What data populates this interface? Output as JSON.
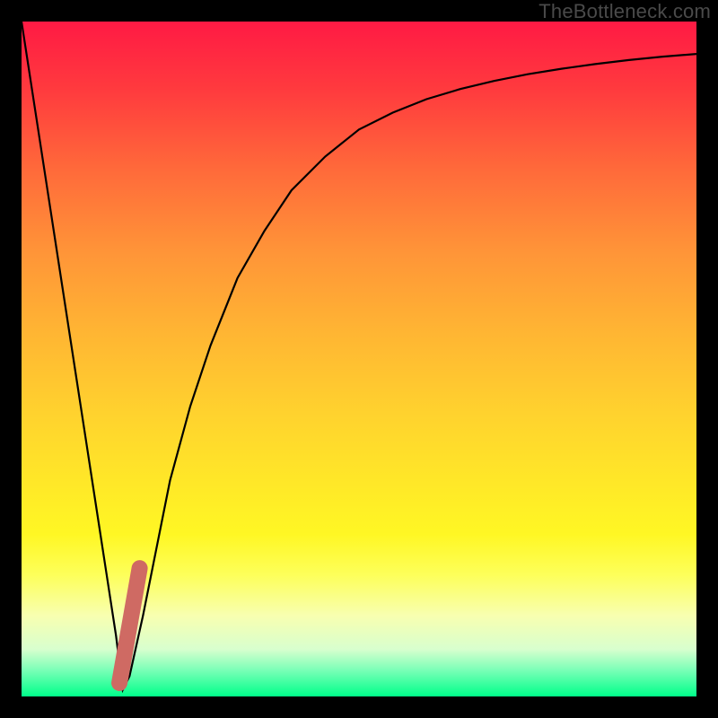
{
  "watermark": "TheBottleneck.com",
  "colors": {
    "black": "#000000",
    "curve": "#000000",
    "accent": "#cf6a63",
    "gradient_top": "#ff1a44",
    "gradient_bottom": "#00ff8a"
  },
  "chart_data": {
    "type": "line",
    "title": "",
    "xlabel": "",
    "ylabel": "",
    "xlim": [
      0,
      100
    ],
    "ylim": [
      0,
      100
    ],
    "grid": false,
    "legend": false,
    "series": [
      {
        "name": "bottleneck-curve",
        "x": [
          0,
          2,
          4,
          6,
          8,
          10,
          12,
          14,
          15,
          16,
          18,
          20,
          22,
          25,
          28,
          32,
          36,
          40,
          45,
          50,
          55,
          60,
          65,
          70,
          75,
          80,
          85,
          90,
          95,
          100
        ],
        "y": [
          100,
          87,
          74,
          61,
          48,
          35,
          22,
          9,
          1,
          3,
          12,
          22,
          32,
          43,
          52,
          62,
          69,
          75,
          80,
          84,
          86.5,
          88.5,
          90,
          91.2,
          92.2,
          93,
          93.7,
          94.3,
          94.8,
          95.2
        ]
      },
      {
        "name": "accent-marker",
        "x": [
          14.5,
          17.5
        ],
        "y": [
          2,
          19
        ]
      }
    ]
  }
}
